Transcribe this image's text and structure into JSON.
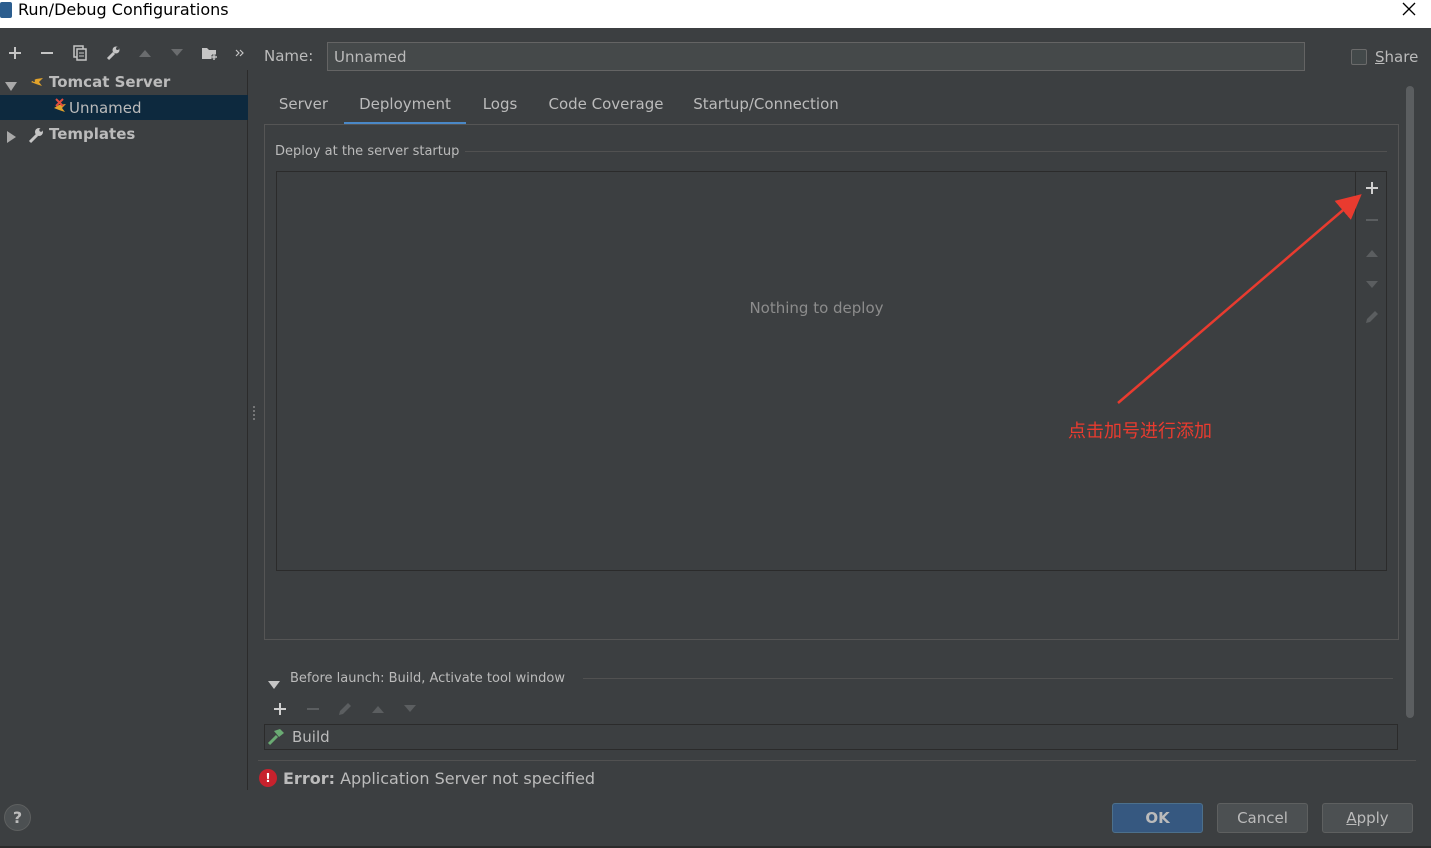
{
  "window": {
    "title": "Run/Debug Configurations"
  },
  "toolbar": {
    "icons": [
      "add-icon",
      "remove-icon",
      "copy-icon",
      "wrench-icon",
      "move-up-icon",
      "move-down-icon",
      "folder-add-icon",
      "more-icon"
    ]
  },
  "tree": {
    "items": [
      {
        "label": "Tomcat Server",
        "icon": "tomcat-icon",
        "expanded": true
      },
      {
        "label": "Unnamed",
        "icon": "tomcat-config-error-icon",
        "selected": true
      },
      {
        "label": "Templates",
        "icon": "wrench-icon",
        "expanded": false
      }
    ]
  },
  "name": {
    "label": "Name:",
    "value": "Unnamed"
  },
  "share": {
    "label_prefix": "",
    "label_underlined": "S",
    "label_rest": "hare",
    "checked": false
  },
  "tabs": [
    {
      "label": "Server"
    },
    {
      "label": "Deployment",
      "active": true
    },
    {
      "label": "Logs"
    },
    {
      "label": "Code Coverage"
    },
    {
      "label": "Startup/Connection"
    }
  ],
  "deployment": {
    "section_title": "Deploy at the server startup",
    "empty_text": "Nothing to deploy",
    "side_buttons": [
      "add-icon",
      "remove-icon",
      "move-up-icon",
      "move-down-icon",
      "edit-icon"
    ]
  },
  "annotation": {
    "text": "点击加号进行添加",
    "color": "#e93b2f"
  },
  "before_launch": {
    "title": "Before launch: Build, Activate tool window",
    "buttons": [
      "add-icon",
      "remove-icon",
      "edit-icon",
      "move-up-icon",
      "move-down-icon"
    ],
    "items": [
      {
        "label": "Build",
        "icon": "build-hammer-icon"
      }
    ]
  },
  "error": {
    "prefix": "Error:",
    "message": " Application Server not specified"
  },
  "buttons": {
    "ok": "OK",
    "cancel": "Cancel",
    "apply_underlined": "A",
    "apply_rest": "pply",
    "help": "?"
  },
  "colors": {
    "background": "#3c3f41",
    "selection": "#0d293e",
    "accent": "#4a88c7",
    "error": "#c7222d"
  }
}
